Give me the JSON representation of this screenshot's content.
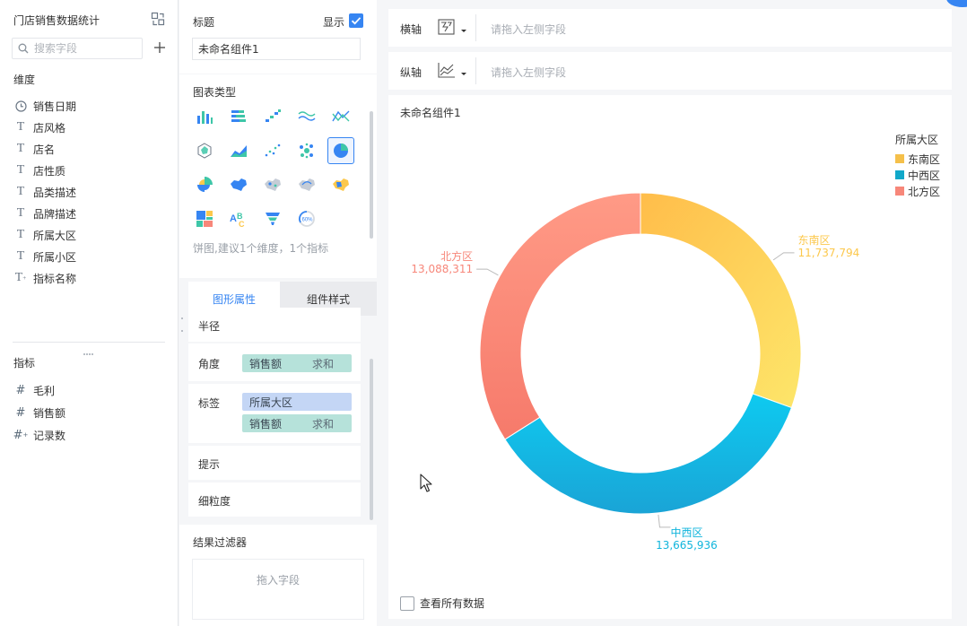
{
  "left": {
    "title": "门店销售数据统计",
    "search_placeholder": "搜索字段",
    "dimension_label": "维度",
    "dimensions": [
      {
        "icon": "clock-icon",
        "label": "销售日期"
      },
      {
        "icon": "text-icon",
        "label": "店风格"
      },
      {
        "icon": "text-icon",
        "label": "店名"
      },
      {
        "icon": "text-icon",
        "label": "店性质"
      },
      {
        "icon": "text-icon",
        "label": "品类描述"
      },
      {
        "icon": "text-icon",
        "label": "品牌描述"
      },
      {
        "icon": "text-icon",
        "label": "所属大区"
      },
      {
        "icon": "text-icon",
        "label": "所属小区"
      },
      {
        "icon": "text-plus-icon",
        "label": "指标名称"
      }
    ],
    "metric_label": "指标",
    "metrics": [
      {
        "icon": "hash-icon",
        "label": "毛利"
      },
      {
        "icon": "hash-icon",
        "label": "销售额"
      },
      {
        "icon": "hash-plus-icon",
        "label": "记录数"
      }
    ]
  },
  "config": {
    "title_label": "标题",
    "show_label": "显示",
    "show_checked": true,
    "title_value": "未命名组件1",
    "chart_type_label": "图表类型",
    "chart_type_hint": "饼图,建议1个维度，1个指标",
    "selected_chart_type": "pie-chart",
    "tabs": {
      "graphic": "图形属性",
      "style": "组件样式"
    },
    "props": {
      "radius": "半径",
      "angle": "角度",
      "angle_field": "销售额",
      "angle_agg": "求和",
      "label": "标签",
      "label_dim": "所属大区",
      "label_metric": "销售额",
      "label_agg": "求和",
      "tooltip": "提示",
      "granularity": "细粒度"
    },
    "filter_label": "结果过滤器",
    "filter_drop": "拖入字段"
  },
  "axes": {
    "x_label": "横轴",
    "y_label": "纵轴",
    "placeholder": "请拖入左侧字段"
  },
  "chart": {
    "component_title": "未命名组件1",
    "view_all_label": "查看所有数据",
    "view_all_checked": false
  },
  "chart_data": {
    "type": "pie",
    "variant": "donut",
    "legend_title": "所属大区",
    "legend_position": "top-right",
    "categories": [
      "东南区",
      "中西区",
      "北方区"
    ],
    "values": [
      11737794,
      13665936,
      13088311
    ],
    "value_labels": [
      "11,737,794",
      "13,665,936",
      "13,088,311"
    ],
    "colors": [
      "#fcc84c",
      "#11b5dc",
      "#f7877a"
    ]
  },
  "colors": {
    "accent": "#3685f2",
    "pill_green": "#b6e2da",
    "pill_blue": "#c4d6f5"
  }
}
